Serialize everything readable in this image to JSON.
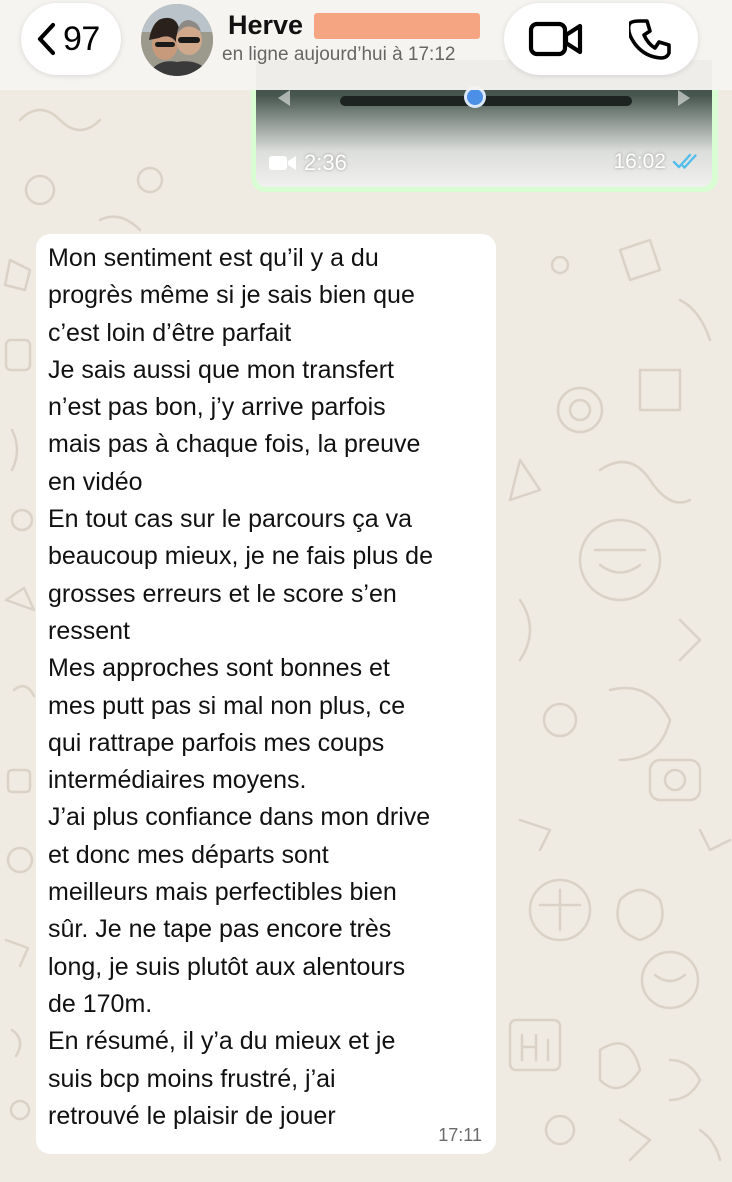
{
  "header": {
    "back_count": "97",
    "contact_name": "Herve",
    "status": "en ligne aujourd’hui à 17:12"
  },
  "video_message": {
    "duration": "2:36",
    "time": "16:02",
    "read_status_color": "#53bdeb"
  },
  "incoming_message": {
    "text": "Mon sentiment est qu’il y a du\nprogrès même si je sais bien que\nc’est loin d’être parfait\nJe sais aussi que mon transfert\nn’est pas bon, j’y arrive parfois\nmais pas à chaque fois, la preuve\nen vidéo\nEn tout cas sur le parcours ça va\nbeaucoup mieux, je ne fais plus de\ngrosses erreurs et le score s’en\nressent\nMes approches sont bonnes et\nmes putt pas si mal non plus, ce\nqui rattrape parfois mes coups\nintermédiaires moyens.\nJ’ai plus confiance dans mon drive\net donc mes départs sont\nmeilleurs mais perfectibles bien\nsûr. Je ne tape pas encore très\nlong, je suis plutôt aux alentours\nde 170m.\nEn résumé, il y’a du mieux et je\nsuis bcp moins frustré, j’ai\nretrouvé le plaisir de jouer",
    "time": "17:11"
  },
  "colors": {
    "chat_background": "#efeae2",
    "outgoing_bubble": "#d9fdd3",
    "incoming_bubble": "#ffffff",
    "name_redaction": "#f5a582"
  }
}
